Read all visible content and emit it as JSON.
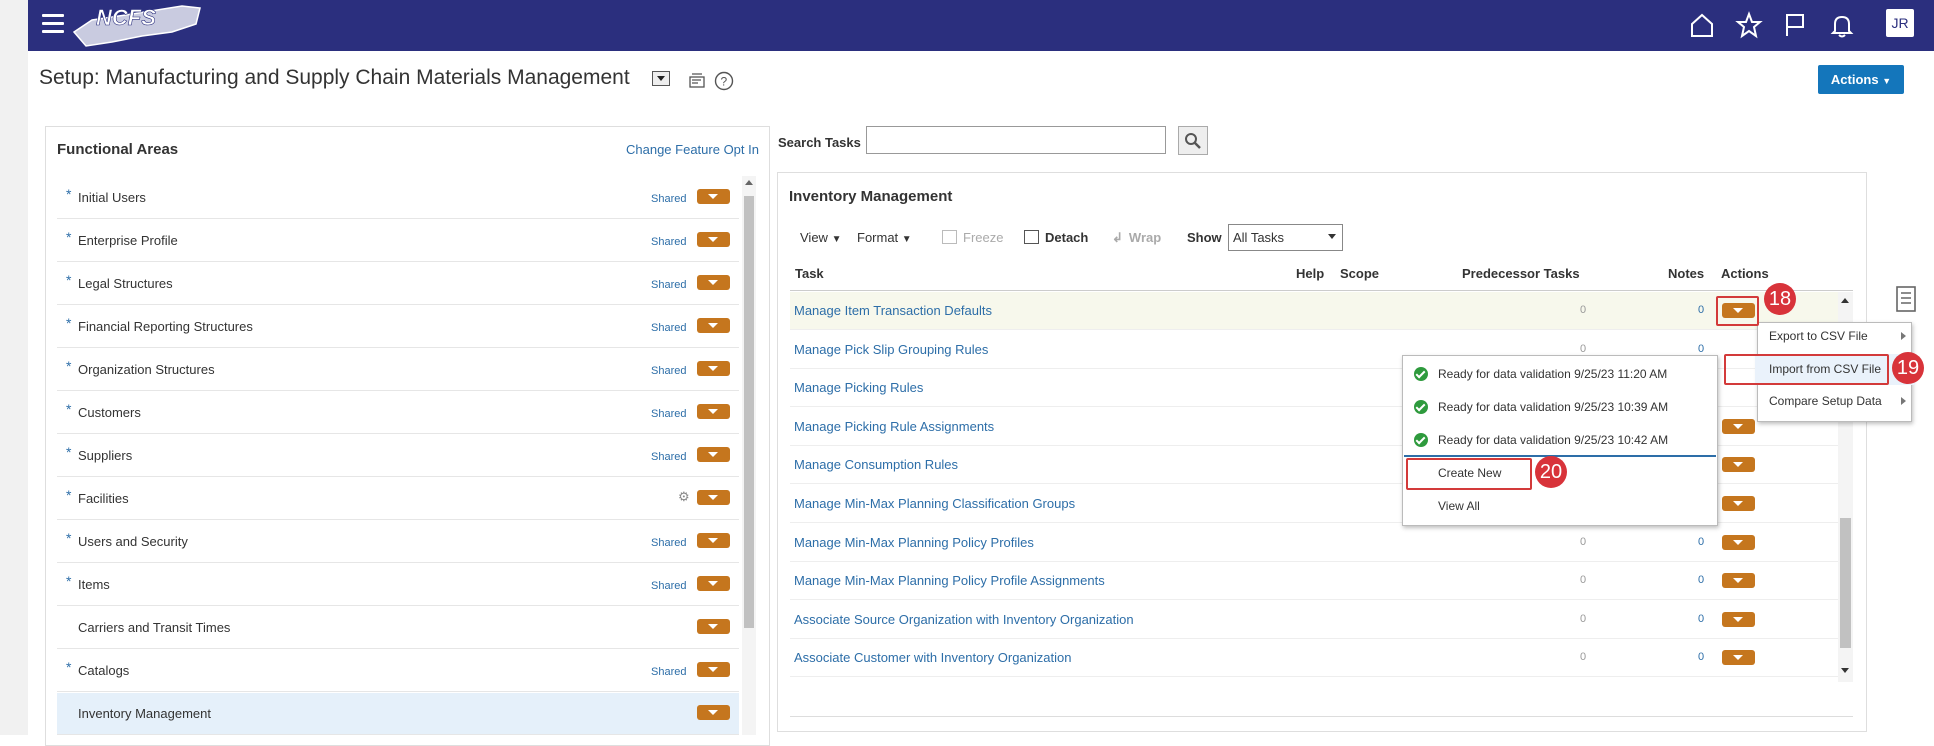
{
  "header": {
    "logo_text": "NCFS",
    "user_initials": "JR",
    "icons": [
      "menu-icon",
      "home-icon",
      "star-icon",
      "flag-icon",
      "bell-icon"
    ]
  },
  "page": {
    "title": "Setup: Manufacturing and Supply Chain Materials Management",
    "actions_label": "Actions"
  },
  "functional_areas": {
    "heading": "Functional Areas",
    "change_link": "Change Feature Opt In",
    "shared_label": "Shared",
    "items": [
      {
        "label": "Initial Users",
        "required": "*",
        "shared": "Shared"
      },
      {
        "label": "Enterprise Profile",
        "required": "*",
        "shared": "Shared"
      },
      {
        "label": "Legal Structures",
        "required": "*",
        "shared": "Shared"
      },
      {
        "label": "Financial Reporting Structures",
        "required": "*",
        "shared": "Shared"
      },
      {
        "label": "Organization Structures",
        "required": "*",
        "shared": "Shared"
      },
      {
        "label": "Customers",
        "required": "*",
        "shared": "Shared"
      },
      {
        "label": "Suppliers",
        "required": "*",
        "shared": "Shared"
      },
      {
        "label": "Facilities",
        "required": "*",
        "shared": ""
      },
      {
        "label": "Users and Security",
        "required": "*",
        "shared": "Shared"
      },
      {
        "label": "Items",
        "required": "*",
        "shared": "Shared"
      },
      {
        "label": "Carriers and Transit Times",
        "required": "",
        "shared": ""
      },
      {
        "label": "Catalogs",
        "required": "*",
        "shared": "Shared"
      },
      {
        "label": "Inventory Management",
        "required": "",
        "shared": ""
      }
    ]
  },
  "search": {
    "label": "Search Tasks",
    "value": ""
  },
  "tasks_panel": {
    "heading": "Inventory Management",
    "toolbar": {
      "view": "View",
      "format": "Format",
      "freeze": "Freeze",
      "detach": "Detach",
      "wrap": "Wrap",
      "show_label": "Show",
      "show_value": "All Tasks"
    },
    "columns": {
      "task": "Task",
      "help": "Help",
      "scope": "Scope",
      "predecessor": "Predecessor Tasks",
      "notes": "Notes",
      "actions": "Actions"
    },
    "rows": [
      {
        "task": "Manage Item Transaction Defaults",
        "pred": "0",
        "notes": "0"
      },
      {
        "task": "Manage Pick Slip Grouping Rules",
        "pred": "0",
        "notes": "0"
      },
      {
        "task": "Manage Picking Rules",
        "pred": "",
        "notes": ""
      },
      {
        "task": "Manage Picking Rule Assignments",
        "pred": "",
        "notes": ""
      },
      {
        "task": "Manage Consumption Rules",
        "pred": "",
        "notes": ""
      },
      {
        "task": "Manage Min-Max Planning Classification Groups",
        "pred": "",
        "notes": ""
      },
      {
        "task": "Manage Min-Max Planning Policy Profiles",
        "pred": "0",
        "notes": "0"
      },
      {
        "task": "Manage Min-Max Planning Policy Profile Assignments",
        "pred": "0",
        "notes": "0"
      },
      {
        "task": "Associate Source Organization with Inventory Organization",
        "pred": "0",
        "notes": "0"
      },
      {
        "task": "Associate Customer with Inventory Organization",
        "pred": "0",
        "notes": "0"
      }
    ]
  },
  "actions_menu": {
    "items": [
      "Export to CSV File",
      "Import from CSV File",
      "Compare Setup Data"
    ]
  },
  "import_submenu": {
    "items": [
      "Ready for data validation 9/25/23 11:20 AM",
      "Ready for data validation 9/25/23 10:39 AM",
      "Ready for data validation 9/25/23 10:42 AM"
    ],
    "create_new": "Create New",
    "view_all": "View All"
  },
  "step_badges": [
    "18",
    "19",
    "20"
  ]
}
